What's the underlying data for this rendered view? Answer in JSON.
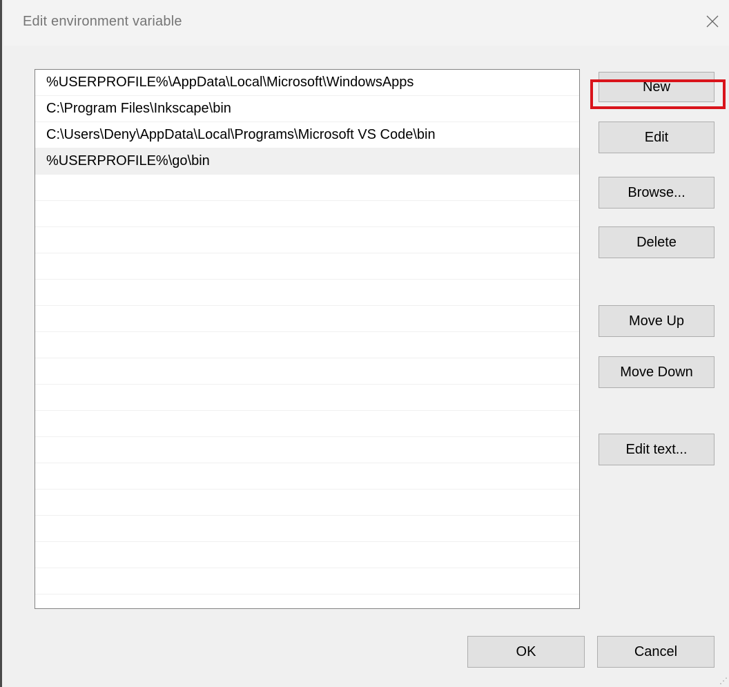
{
  "window": {
    "title": "Edit environment variable",
    "close_icon": "close-icon"
  },
  "list": {
    "items": [
      "%USERPROFILE%\\AppData\\Local\\Microsoft\\WindowsApps",
      "C:\\Program Files\\Inkscape\\bin",
      "C:\\Users\\Deny\\AppData\\Local\\Programs\\Microsoft VS Code\\bin",
      "%USERPROFILE%\\go\\bin"
    ],
    "selected_index": 3
  },
  "buttons": {
    "new": "New",
    "edit": "Edit",
    "browse": "Browse...",
    "delete": "Delete",
    "move_up": "Move Up",
    "move_down": "Move Down",
    "edit_text": "Edit text...",
    "ok": "OK",
    "cancel": "Cancel"
  },
  "colors": {
    "highlight": "#d9141b",
    "button_face": "#e1e1e1",
    "selected_row": "#f0f0f0"
  }
}
